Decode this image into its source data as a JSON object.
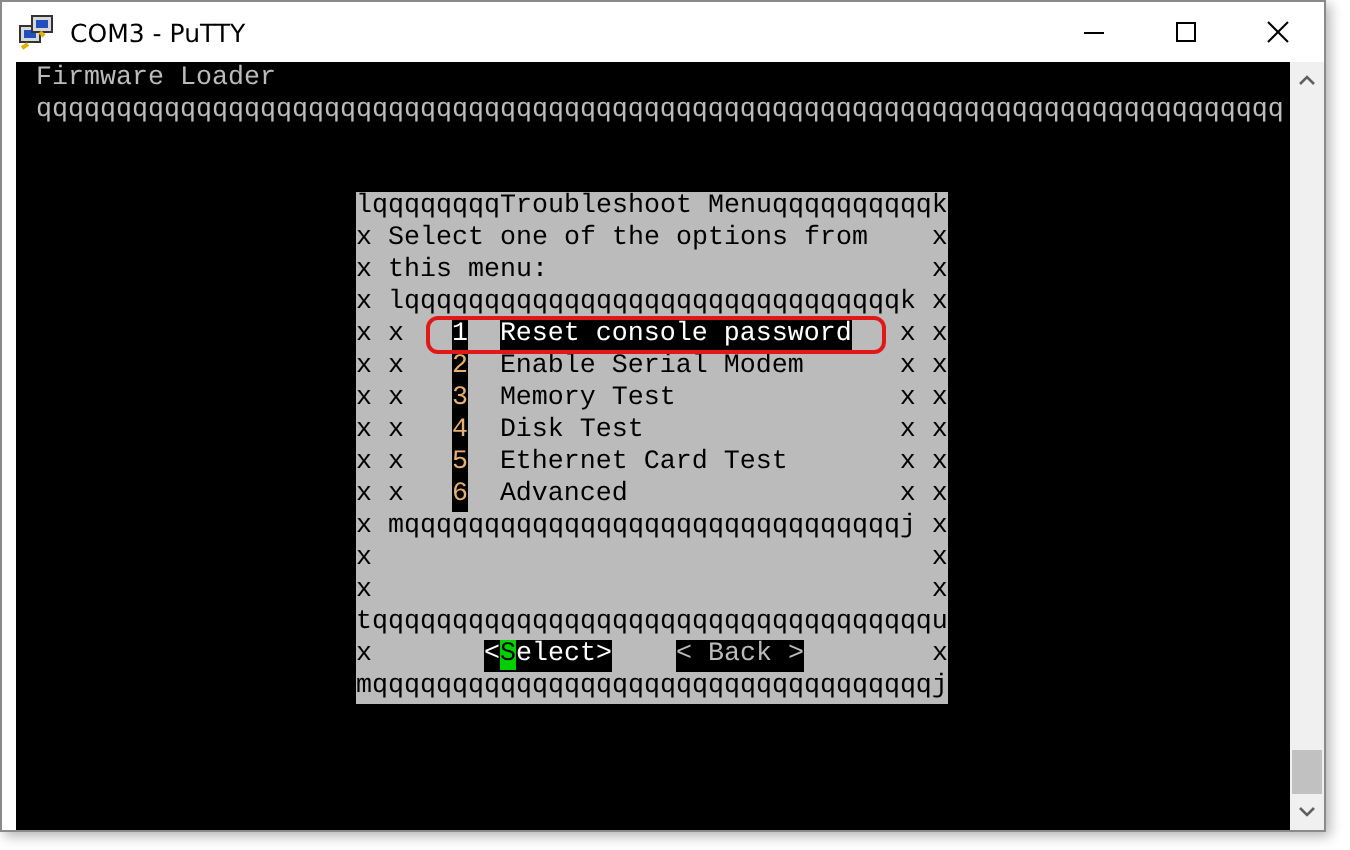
{
  "window": {
    "title": "COM3 - PuTTY"
  },
  "terminal": {
    "header": "Firmware Loader",
    "rule": "qqqqqqqqqqqqqqqqqqqqqqqqqqqqqqqqqqqqqqqqqqqqqqqqqqqqqqqqqqqqqqqqqqqqqqqqqqqqqq"
  },
  "dialog": {
    "title_line": "lqqqqqqqqTroubleshoot Menuqqqqqqqqqqk",
    "prompt_lines": [
      "x Select one of the options from    x",
      "x this menu:                        x"
    ],
    "inner_top": "x lqqqqqqqqqqqqqqqqqqqqqqqqqqqqqqqk x",
    "items": [
      {
        "prefix": "x x",
        "number": "1",
        "label": "Reset console password",
        "suffix": "x x",
        "selected": true
      },
      {
        "prefix": "x x",
        "number": "2",
        "label": "Enable Serial Modem",
        "suffix": "x x",
        "selected": false
      },
      {
        "prefix": "x x",
        "number": "3",
        "label": "Memory Test",
        "suffix": "x x",
        "selected": false
      },
      {
        "prefix": "x x",
        "number": "4",
        "label": "Disk Test",
        "suffix": "x x",
        "selected": false
      },
      {
        "prefix": "x x",
        "number": "5",
        "label": "Ethernet Card Test",
        "suffix": "x x",
        "selected": false
      },
      {
        "prefix": "x x",
        "number": "6",
        "label": "Advanced",
        "suffix": "x x",
        "selected": false
      }
    ],
    "inner_bottom": "x mqqqqqqqqqqqqqqqqqqqqqqqqqqqqqqqj x",
    "blank_lines": [
      "x                                   x",
      "x                                   x"
    ],
    "separator": "tqqqqqqqqqqqqqqqqqqqqqqqqqqqqqqqqqqqu",
    "button_row": {
      "left": "x",
      "right": "x",
      "buttons": [
        {
          "label": "<Select>",
          "selected": true
        },
        {
          "label": "< Back >",
          "selected": false
        }
      ]
    },
    "bottom_line": "mqqqqqqqqqqqqqqqqqqqqqqqqqqqqqqqqqqqj"
  }
}
